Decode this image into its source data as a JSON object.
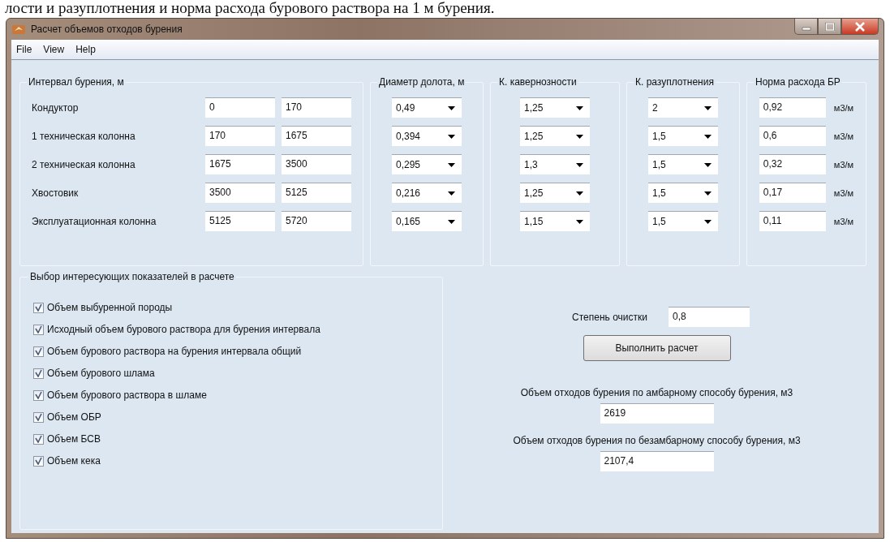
{
  "document_text": "лости и разуплотнения и норма расхода бурового раствора на 1 м бурения.",
  "window": {
    "title": "Расчет объемов отходов бурения"
  },
  "menu": [
    {
      "label": "File"
    },
    {
      "label": "View"
    },
    {
      "label": "Help"
    }
  ],
  "interval_group": {
    "title": "Интервал бурения, м",
    "rows": [
      {
        "name": "Кондуктор",
        "from": "0",
        "to": "170"
      },
      {
        "name": "1 техническая колонна",
        "from": "170",
        "to": "1675"
      },
      {
        "name": "2 техническая колонна",
        "from": "1675",
        "to": "3500"
      },
      {
        "name": "Хвостовик",
        "from": "3500",
        "to": "5125"
      },
      {
        "name": "Эксплуатационная колонна",
        "from": "5125",
        "to": "5720"
      }
    ]
  },
  "parameter_groups": [
    {
      "title": "Диаметр долота, м",
      "kind": "dropdown",
      "values": [
        "0,49",
        "0,394",
        "0,295",
        "0,216",
        "0,165"
      ]
    },
    {
      "title": "К. кавернозности",
      "kind": "dropdown",
      "values": [
        "1,25",
        "1,25",
        "1,3",
        "1,25",
        "1,15"
      ]
    },
    {
      "title": "К. разуплотнения",
      "kind": "dropdown",
      "values": [
        "2",
        "1,5",
        "1,5",
        "1,5",
        "1,5"
      ]
    },
    {
      "title": "Норма расхода БР",
      "kind": "field",
      "values": [
        {
          "value": "0,92",
          "unit": "м3/м"
        },
        {
          "value": "0,6",
          "unit": "м3/м"
        },
        {
          "value": "0,32",
          "unit": "м3/м"
        },
        {
          "value": "0,17",
          "unit": "м3/м"
        },
        {
          "value": "0,11",
          "unit": "м3/м"
        }
      ]
    }
  ],
  "indicators": {
    "title": "Выбор интересующих показателей в расчете",
    "items": [
      {
        "label": "Объем выбуренной породы",
        "checked": true
      },
      {
        "label": "Исходный объем бурового раствора для бурения интервала",
        "checked": true
      },
      {
        "label": "Объем бурового раствора на бурения интервала общий",
        "checked": true
      },
      {
        "label": "Объем бурового шлама",
        "checked": true
      },
      {
        "label": "Объем бурового раствора в шламе",
        "checked": true
      },
      {
        "label": "Объем ОБР",
        "checked": true
      },
      {
        "label": "Объем БСВ",
        "checked": true
      },
      {
        "label": "Объем кека",
        "checked": true
      }
    ]
  },
  "cleaning": {
    "label": "Степень очистки",
    "value": "0,8"
  },
  "run_button": "Выполнить расчет",
  "results": [
    {
      "label": "Объем отходов бурения по амбарному способу бурения, м3",
      "value": "2619"
    },
    {
      "label": "Объем отходов бурения по безамбарному способу бурения, м3",
      "value": "2107,4"
    }
  ]
}
